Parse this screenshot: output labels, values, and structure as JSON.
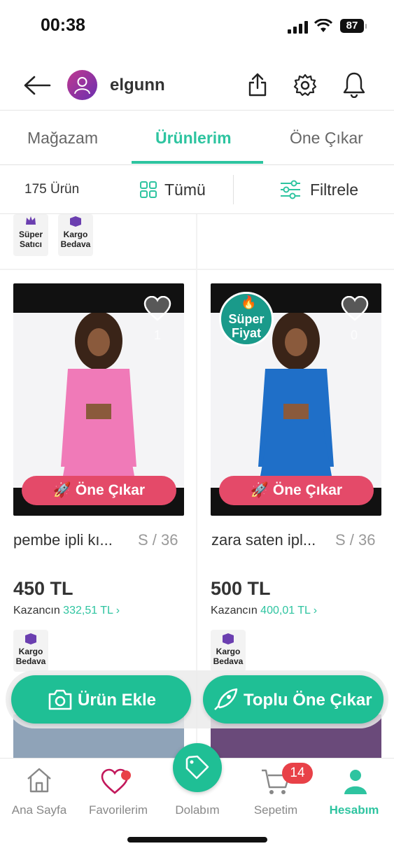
{
  "status_bar": {
    "time": "00:38",
    "battery": "87"
  },
  "header": {
    "username": "elgunn"
  },
  "tabs": [
    {
      "label": "Mağazam"
    },
    {
      "label": "Ürünlerim"
    },
    {
      "label": "Öne Çıkar"
    }
  ],
  "filter_bar": {
    "count": "175 Ürün",
    "view_label": "Tümü",
    "filter_label": "Filtrele"
  },
  "top_badges": {
    "super_seller": "Süper Satıcı",
    "free_shipping": "Kargo Bedava"
  },
  "products": [
    {
      "title": "pembe ipli kı...",
      "size": "S / 36",
      "price": "450 TL",
      "earn_label": "Kazancın",
      "earn_value": "332,51 TL",
      "likes": "1",
      "promo": "Öne Çıkar",
      "badge": "Kargo Bedava",
      "image_color": "#f07ab8"
    },
    {
      "title": "zara saten ipl...",
      "size": "S / 36",
      "price": "500 TL",
      "earn_label": "Kazancın",
      "earn_value": "400,01 TL",
      "likes": "0",
      "promo": "Öne Çıkar",
      "badge": "Kargo Bedava",
      "super_badge": "Süper Fiyat",
      "image_color": "#1f6fc8"
    }
  ],
  "actions": {
    "add_product": "Ürün Ekle",
    "bulk_promote": "Toplu Öne Çıkar"
  },
  "bottom_nav": [
    {
      "label": "Ana Sayfa"
    },
    {
      "label": "Favorilerim"
    },
    {
      "label": "Dolabım"
    },
    {
      "label": "Sepetim",
      "badge": "14"
    },
    {
      "label": "Hesabım"
    }
  ],
  "colors": {
    "accent": "#2ec4a0",
    "promo": "#e44a69",
    "cart_badge": "#e84148"
  }
}
